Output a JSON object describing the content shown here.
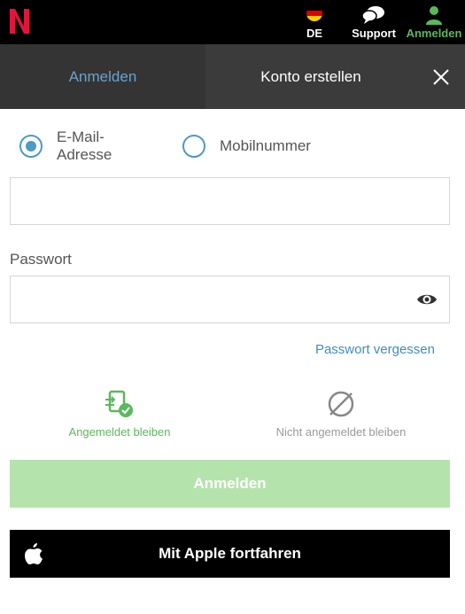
{
  "topbar": {
    "language": "DE",
    "support": "Support",
    "login": "Anmelden"
  },
  "tabs": {
    "login": "Anmelden",
    "register": "Konto erstellen"
  },
  "form": {
    "radio_email": "E-Mail-Adresse",
    "radio_phone": "Mobilnummer",
    "email_value": "",
    "password_label": "Passwort",
    "password_value": "",
    "forgot": "Passwort vergessen",
    "stay_logged_in": "Angemeldet bleiben",
    "not_stay_logged_in": "Nicht angemeldet bleiben",
    "login_button": "Anmelden",
    "apple_button": "Mit Apple fortfahren"
  },
  "colors": {
    "accent_blue": "#4b9ac8",
    "accent_green": "#5cb85c",
    "login_button_disabled": "#b4e3ac"
  },
  "icons": {
    "logo": "brand-n-logo",
    "language": "german-flag-icon",
    "support": "chat-bubbles-icon",
    "login": "user-icon",
    "close": "close-icon",
    "eye": "eye-icon",
    "stay": "device-check-icon",
    "no_stay": "prohibited-icon",
    "apple": "apple-icon"
  }
}
